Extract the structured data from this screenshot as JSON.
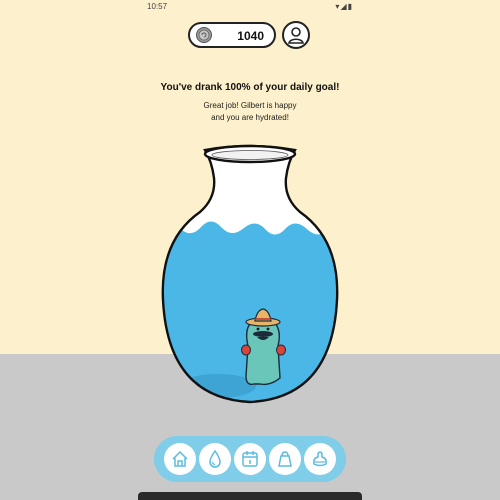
{
  "status_bar": {
    "time": "10:57",
    "icons": [
      "notification-icon",
      "wifi-icon",
      "signal-icon",
      "battery-icon"
    ]
  },
  "header": {
    "coins": "1040",
    "coin_icon": "coin-icon",
    "profile_icon": "person-icon"
  },
  "message": {
    "headline": "You've drank 100% of your daily goal!",
    "line1": "Great job! Gilbert is happy",
    "line2": "and you are hydrated!"
  },
  "hydration": {
    "progress_percent": 100,
    "character": "Gilbert"
  },
  "nav": {
    "items": [
      {
        "icon": "home-icon"
      },
      {
        "icon": "water-drop-icon"
      },
      {
        "icon": "calendar-icon"
      },
      {
        "icon": "shop-bag-icon"
      },
      {
        "icon": "wardrobe-icon"
      }
    ]
  },
  "colors": {
    "background": "#fdf0cc",
    "floor": "#c9c9c9",
    "water": "#4ab7e6",
    "nav": "#7fcde8",
    "accent": "#5bbbe0"
  }
}
